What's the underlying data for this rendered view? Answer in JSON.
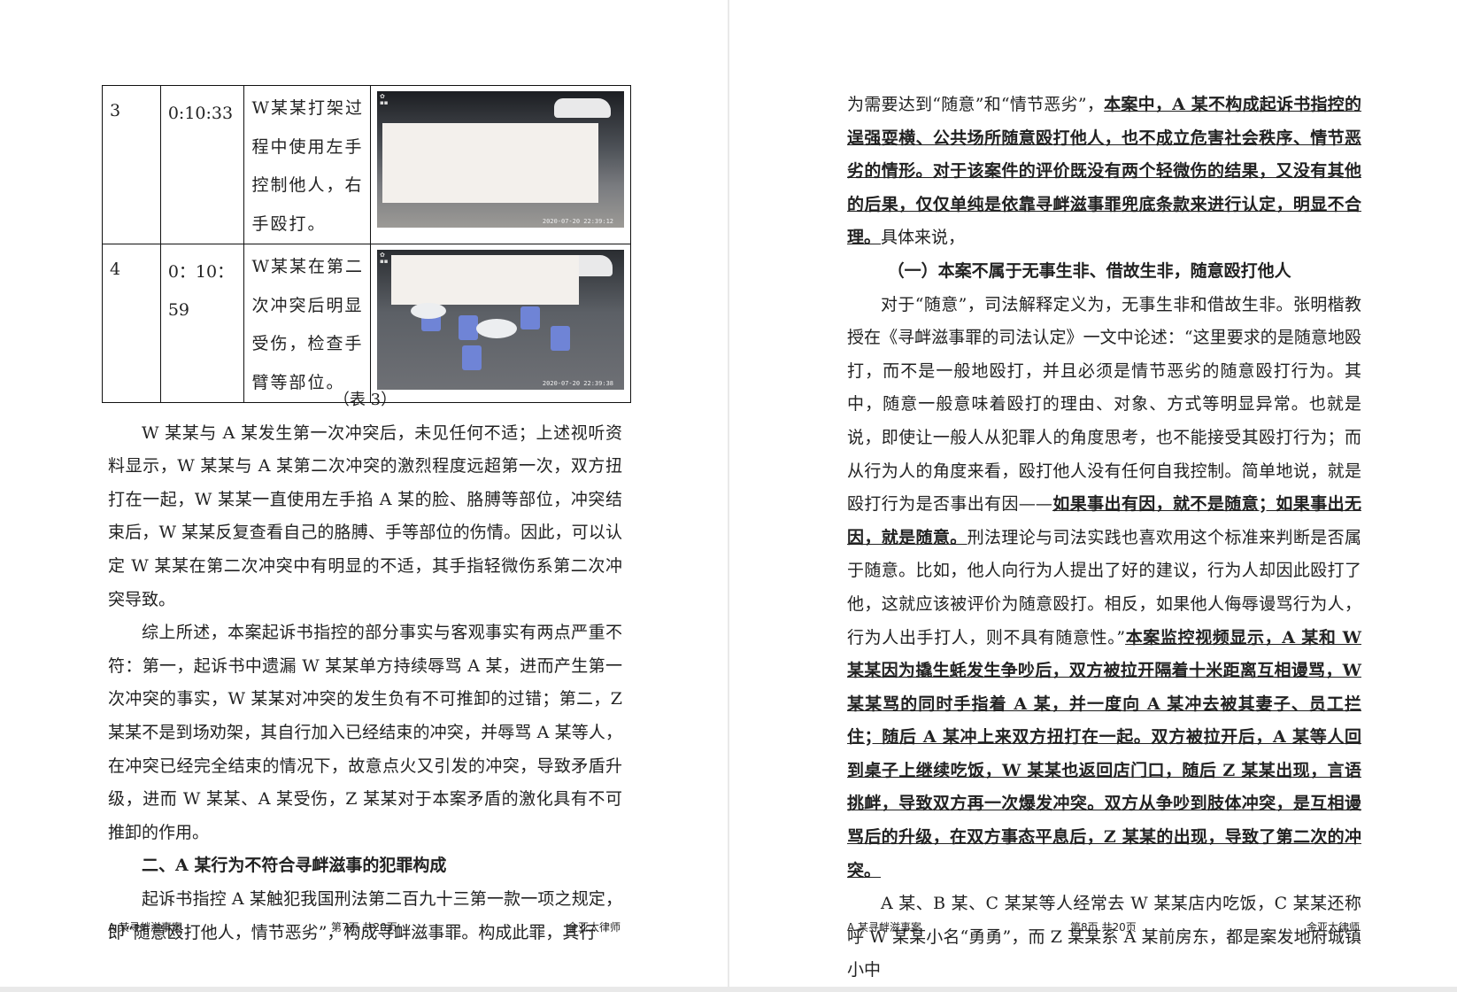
{
  "left_page": {
    "table": {
      "rows": [
        {
          "num": "3",
          "time": "0:10:33",
          "desc": "W某某打架过程中使用左手控制他人，右手殴打。",
          "stamp": "2020-07-20 22:39:12"
        },
        {
          "num": "4",
          "time": "0：10：59",
          "desc": "W某某在第二次冲突后明显受伤，检查手臂等部位。",
          "stamp": "2020-07-20 22:39:38"
        }
      ]
    },
    "caption": "（表 3）",
    "paragraphs": [
      "W 某某与 A 某发生第一次冲突后，未见任何不适；上述视听资料显示，W 某某与 A 某第二次冲突的激烈程度远超第一次，双方扭打在一起，W 某某一直使用左手掐 A 某的脸、胳膊等部位，冲突结束后，W 某某反复查看自己的胳膊、手等部位的伤情。因此，可以认定 W 某某在第二次冲突中有明显的不适，其手指轻微伤系第二次冲突导致。",
      "综上所述，本案起诉书指控的部分事实与客观事实有两点严重不符：第一，起诉书中遗漏 W 某某单方持续辱骂 A 某，进而产生第一次冲突的事实，W 某某对冲突的发生负有不可推卸的过错；第二，Z 某某不是到场劝架，其自行加入已经结束的冲突，并辱骂 A 某等人，在冲突已经完全结束的情况下，故意点火又引发的冲突，导致矛盾升级，进而 W 某某、A 某受伤，Z 某某对于本案矛盾的激化具有不可推卸的作用。"
    ],
    "heading": "二、A 某行为不符合寻衅滋事的犯罪构成",
    "last_paragraph": "起诉书指控 A 某触犯我国刑法第二百九十三第一款一项之规定，即“随意殴打他人，情节恶劣”，构成寻衅滋事罪。构成此罪，其行",
    "footer": {
      "left": "A 某寻衅滋事案",
      "center": "第7页  共20页",
      "right": "金亚太律师"
    }
  },
  "right_page": {
    "p1_lead": "为需要达到“随意”和“情节恶劣”，",
    "p1_bold": "本案中，A 某不构成起诉书指控的逞强耍横、公共场所随意殴打他人，也不成立危害社会秩序、情节恶劣的情形。对于该案件的评价既没有两个轻微伤的结果，又没有其他的后果，仅仅单纯是依靠寻衅滋事罪兜底条款来进行认定，明显不合理。",
    "p1_tail": "具体来说，",
    "heading": "（一）本案不属于无事生非、借故生非，随意殴打他人",
    "p2_a": "对于“随意”，司法解释定义为，无事生非和借故生非。张明楷教授在《寻衅滋事罪的司法认定》一文中论述：“这里要求的是随意地殴打，而不是一般地殴打，并且必须是情节恶劣的随意殴打行为。其中，随意一般意味着殴打的理由、对象、方式等明显异常。也就是说，即使让一般人从犯罪人的角度思考，也不能接受其殴打行为；而从行为人的角度来看，殴打他人没有任何自我控制。简单地说，就是殴打行为是否事出有因——",
    "p2_bold1": "如果事出有因，就不是随意；如果事出无因，就是随意。",
    "p2_b": "刑法理论与司法实践也喜欢用这个标准来判断是否属于随意。比如，他人向行为人提出了好的建议，行为人却因此殴打了他，这就应该被评价为随意殴打。相反，如果他人侮辱谩骂行为人，行为人出手打人，则不具有随意性。”",
    "p2_bold2": "本案监控视频显示，A 某和 W 某某因为撬生蚝发生争吵后，双方被拉开隔着十米距离互相谩骂，W 某某骂的同时手指着 A 某，并一度向 A 某冲去被其妻子、员工拦住；随后 A 某冲上来双方扭打在一起。双方被拉开后，A 某等人回到桌子上继续吃饭，W 某某也返回店门口，随后 Z 某某出现，言语挑衅，导致双方再一次爆发冲突。双方从争吵到肢体冲突，是互相谩骂后的升级，在双方事态平息后，Z 某某的出现，导致了第二次的冲突。",
    "p3": "A 某、B 某、C 某某等人经常去 W 某某店内吃饭，C 某某还称呼 W 某某小名“勇勇”，而 Z 某某系 A 某前房东，都是案发地府城镇小中",
    "footer": {
      "left": "A 某寻衅滋事案",
      "center": "第8页  共20页",
      "right": "金亚太律师"
    }
  }
}
